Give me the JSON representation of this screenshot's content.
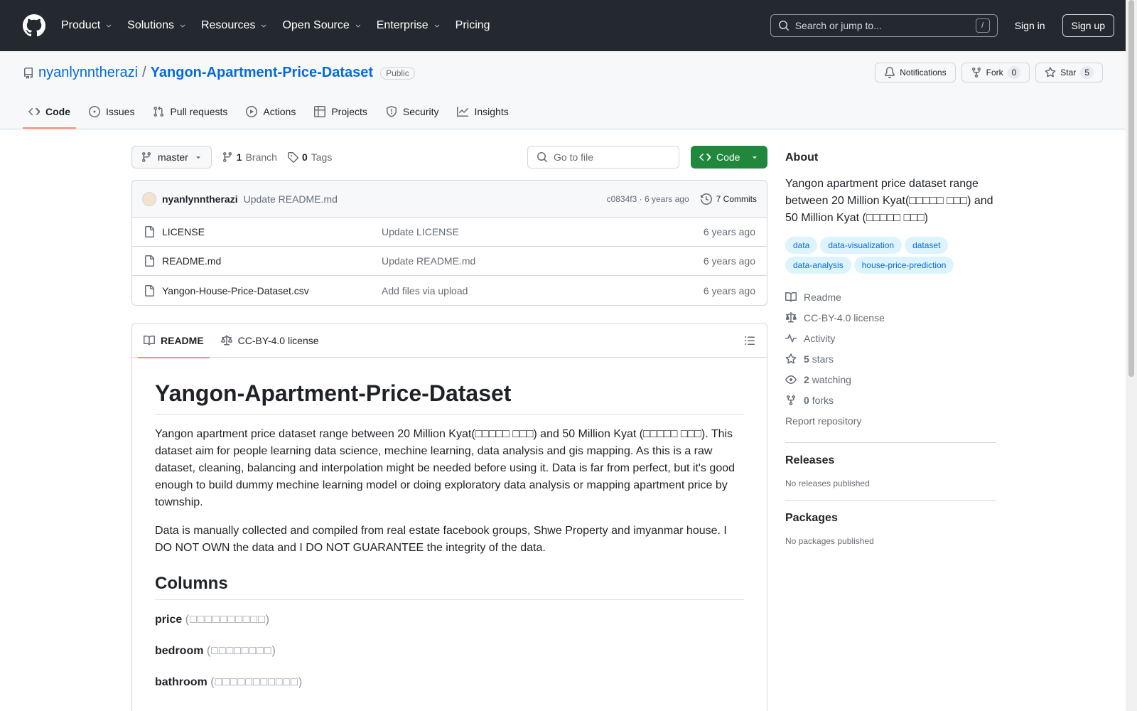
{
  "header": {
    "nav": [
      "Product",
      "Solutions",
      "Resources",
      "Open Source",
      "Enterprise"
    ],
    "pricing": "Pricing",
    "search_placeholder": "Search or jump to...",
    "search_hint": "/",
    "sign_in": "Sign in",
    "sign_up": "Sign up"
  },
  "repo": {
    "owner": "nyanlynntherazi",
    "name": "Yangon-Apartment-Price-Dataset",
    "visibility": "Public",
    "notifications_label": "Notifications",
    "fork_label": "Fork",
    "fork_count": "0",
    "star_label": "Star",
    "star_count": "5"
  },
  "tabs": [
    "Code",
    "Issues",
    "Pull requests",
    "Actions",
    "Projects",
    "Security",
    "Insights"
  ],
  "file_bar": {
    "branch": "master",
    "branch_count": "1",
    "branch_label": "Branch",
    "tag_count": "0",
    "tag_label": "Tags",
    "goto_placeholder": "Go to file",
    "code_label": "Code"
  },
  "commit": {
    "author": "nyanlynntherazi",
    "message": "Update README.md",
    "meta": "c0834f3 · 6 years ago",
    "count": "7 Commits"
  },
  "files": [
    {
      "name": "LICENSE",
      "message": "Update LICENSE",
      "age": "6 years ago"
    },
    {
      "name": "README.md",
      "message": "Update README.md",
      "age": "6 years ago"
    },
    {
      "name": "Yangon-House-Price-Dataset.csv",
      "message": "Add files via upload",
      "age": "6 years ago"
    }
  ],
  "readme": {
    "tab_readme": "README",
    "tab_license": "CC-BY-4.0 license",
    "title": "Yangon-Apartment-Price-Dataset",
    "p1": "Yangon apartment price dataset range between 20 Million Kyat(□□□□□ □□□) and 50 Million Kyat (□□□□□ □□□). This dataset aim for people learning data science, mechine learning, data analysis and gis mapping. As this is a raw dataset, cleaning, balancing and interpolation might be needed before using it. Data is far from perfect, but it's good enough to build dummy mechine learning model or doing exploratory data analysis or mapping apartment price by township.",
    "p2": "Data is manually collected and compiled from real estate facebook groups, Shwe Property and imyanmar house. I DO NOT OWN the data and I DO NOT GUARANTEE the integrity of the data.",
    "columns_heading": "Columns",
    "columns": [
      {
        "name": "price",
        "mm": "(□□□□□□□□□□)"
      },
      {
        "name": "bedroom",
        "mm": "(□□□□□□□□)"
      },
      {
        "name": "bathroom",
        "mm": "(□□□□□□□□□□□)"
      }
    ]
  },
  "about": {
    "heading": "About",
    "description": "Yangon apartment price dataset range between 20 Million Kyat(□□□□□ □□□) and 50 Million Kyat (□□□□□ □□□)",
    "topics": [
      "data",
      "data-visualization",
      "dataset",
      "data-analysis",
      "house-price-prediction"
    ],
    "readme": "Readme",
    "license": "CC-BY-4.0 license",
    "activity": "Activity",
    "stars_count": "5",
    "stars_label": "stars",
    "watching_count": "2",
    "watching_label": "watching",
    "forks_count": "0",
    "forks_label": "forks",
    "report": "Report repository"
  },
  "releases": {
    "heading": "Releases",
    "note": "No releases published"
  },
  "packages": {
    "heading": "Packages",
    "note": "No packages published"
  }
}
